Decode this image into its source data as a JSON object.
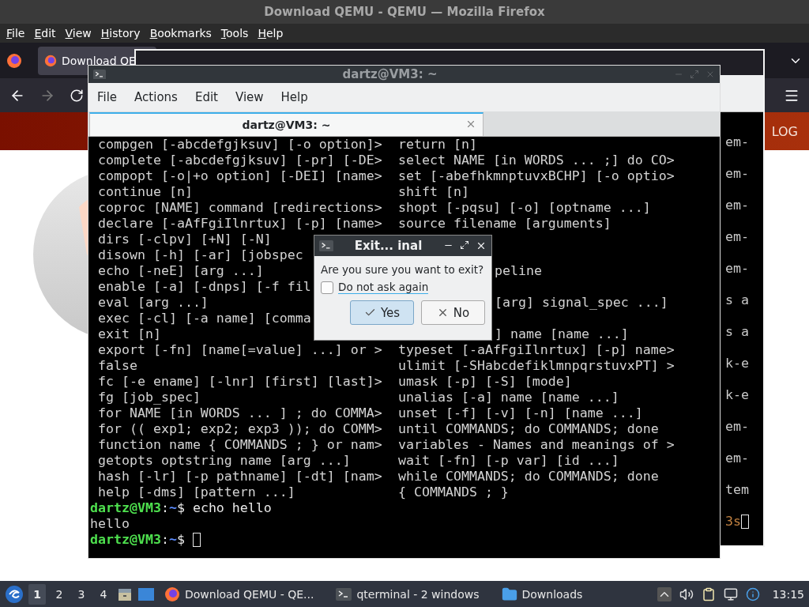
{
  "browser": {
    "title": "Download QEMU - QEMU — Mozilla Firefox",
    "menu": [
      "File",
      "Edit",
      "View",
      "History",
      "Bookmarks",
      "Tools",
      "Help"
    ],
    "tabs": [
      {
        "label": "Download QE",
        "selected": true
      }
    ],
    "banner_text": "LOG"
  },
  "back_terminal": {
    "lines": [
      {
        "kind": "text",
        "text": "em-"
      },
      {
        "kind": "text",
        "text": "em-"
      },
      {
        "kind": "text",
        "text": "em-"
      },
      {
        "kind": "text",
        "text": "em-"
      },
      {
        "kind": "text",
        "text": "em-"
      },
      {
        "kind": "text",
        "text": "s a"
      },
      {
        "kind": "text",
        "text": "s a"
      },
      {
        "kind": "text",
        "text": "k-e"
      },
      {
        "kind": "text",
        "text": "k-e"
      },
      {
        "kind": "text",
        "text": "em-"
      },
      {
        "kind": "text",
        "text": "em-"
      },
      {
        "kind": "text",
        "text": "tem"
      },
      {
        "kind": "prompt",
        "text": "3s"
      }
    ]
  },
  "terminal": {
    "title": "dartz@VM3: ~",
    "menu": [
      "File",
      "Actions",
      "Edit",
      "View",
      "Help"
    ],
    "tabs": [
      {
        "label": "dartz@VM3: ~",
        "selected": true
      }
    ],
    "rows": [
      {
        "left": "compgen [-abcdefgjksuv] [-o option]>",
        "right": "return [n]"
      },
      {
        "left": "complete [-abcdefgjksuv] [-pr] [-DE>",
        "right": "select NAME [in WORDS ... ;] do CO>"
      },
      {
        "left": "compopt [-o|+o option] [-DEI] [name>",
        "right": "set [-abefhkmnptuvxBCHP] [-o optio>"
      },
      {
        "left": "continue [n]",
        "right": "shift [n]"
      },
      {
        "left": "coproc [NAME] command [redirections>",
        "right": "shopt [-pqsu] [-o] [optname ...]"
      },
      {
        "left": "declare [-aAfFgiIlnrtux] [-p] [name>",
        "right": "source filename [arguments]"
      },
      {
        "left": "dirs [-clpv] [+N] [-N]"
      },
      {
        "left": "disown [-h] [-ar] [jobspec"
      },
      {
        "left": "echo [-neE] [arg ...]",
        "right_beside_dialog": "peline"
      },
      {
        "left": "enable [-a] [-dnps] [-f fil"
      },
      {
        "left": "eval [arg ...]",
        "right_beside_dialog": "[arg] signal_spec ...]"
      },
      {
        "left": "exec [-cl] [-a name] [comma"
      },
      {
        "left": "exit [n]",
        "right_beside_dialog": "] name [name ...]"
      },
      {
        "left": "export [-fn] [name[=value] ...] or >",
        "right": "typeset [-aAfFgiIlnrtux] [-p] name>"
      },
      {
        "left": "false",
        "right": "ulimit [-SHabcdefiklmnpqrstuvxPT] >"
      },
      {
        "left": "fc [-e ename] [-lnr] [first] [last]>",
        "right": "umask [-p] [-S] [mode]"
      },
      {
        "left": "fg [job_spec]",
        "right": "unalias [-a] name [name ...]"
      },
      {
        "left": "for NAME [in WORDS ... ] ; do COMMA>",
        "right": "unset [-f] [-v] [-n] [name ...]"
      },
      {
        "left": "for (( exp1; exp2; exp3 )); do COMM>",
        "right": "until COMMANDS; do COMMANDS; done"
      },
      {
        "left": "function name { COMMANDS ; } or nam>",
        "right": "variables - Names and meanings of >"
      },
      {
        "left": "getopts optstring name [arg ...]",
        "right": "wait [-fn] [-p var] [id ...]"
      },
      {
        "left": "hash [-lr] [-p pathname] [-dt] [nam>",
        "right": "while COMMANDS; do COMMANDS; done"
      },
      {
        "left": "help [-dms] [pattern ...]",
        "right": "{ COMMANDS ; }"
      }
    ],
    "session": [
      {
        "kind": "prompt",
        "parts": [
          {
            "kind": "user",
            "text": "dartz@VM3"
          },
          {
            "kind": "plain",
            "text": ":"
          },
          {
            "kind": "path",
            "text": "~"
          },
          {
            "kind": "plain",
            "text": "$ echo hello"
          }
        ],
        "cursor": false
      },
      {
        "kind": "output",
        "text": "hello"
      },
      {
        "kind": "prompt",
        "parts": [
          {
            "kind": "user",
            "text": "dartz@VM3"
          },
          {
            "kind": "plain",
            "text": ":"
          },
          {
            "kind": "path",
            "text": "~"
          },
          {
            "kind": "plain",
            "text": "$ "
          }
        ],
        "cursor": true
      }
    ]
  },
  "dialog": {
    "title": "Exit... inal",
    "message": "Are you sure you want to exit?",
    "checkbox": {
      "label": "Do not ask again",
      "checked": false
    },
    "buttons": [
      {
        "kind": "yes",
        "label": "Yes",
        "default": true
      },
      {
        "kind": "no",
        "label": "No",
        "default": false
      }
    ]
  },
  "taskbar": {
    "workspaces": [
      {
        "label": "1",
        "selected": true
      },
      {
        "label": "2",
        "selected": false
      },
      {
        "label": "3",
        "selected": false
      },
      {
        "label": "4",
        "selected": false
      }
    ],
    "tasks": [
      {
        "kind": "browser",
        "label": "Download QEMU - QE..."
      },
      {
        "kind": "terminal",
        "label": "qterminal - 2 windows"
      },
      {
        "kind": "folder",
        "label": "Downloads"
      }
    ],
    "clock": "13:15"
  }
}
